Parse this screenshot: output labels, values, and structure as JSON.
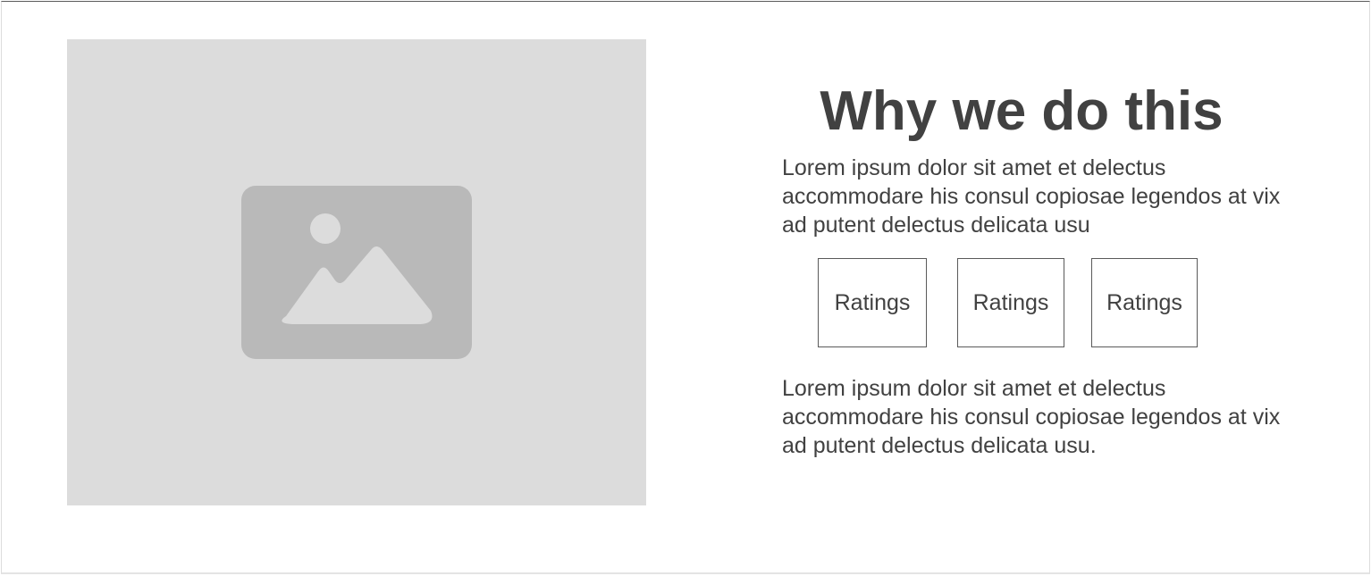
{
  "image": {
    "icon": "image-placeholder-icon",
    "panel_color": "#dcdcdc",
    "icon_color": "#b9b9b9"
  },
  "section": {
    "title": "Why we do this",
    "intro": "Lorem ipsum dolor sit amet et delectus accommodare his consul copiosae legendos at vix ad putent delectus delicata usu",
    "ratings": [
      {
        "label": "Ratings"
      },
      {
        "label": "Ratings"
      },
      {
        "label": "Ratings"
      }
    ],
    "outro": "Lorem ipsum dolor sit amet et delectus accommodare his consul copiosae legendos at vix ad putent delectus delicata usu."
  },
  "colors": {
    "text": "#414141",
    "border": "#5a5a5a"
  }
}
